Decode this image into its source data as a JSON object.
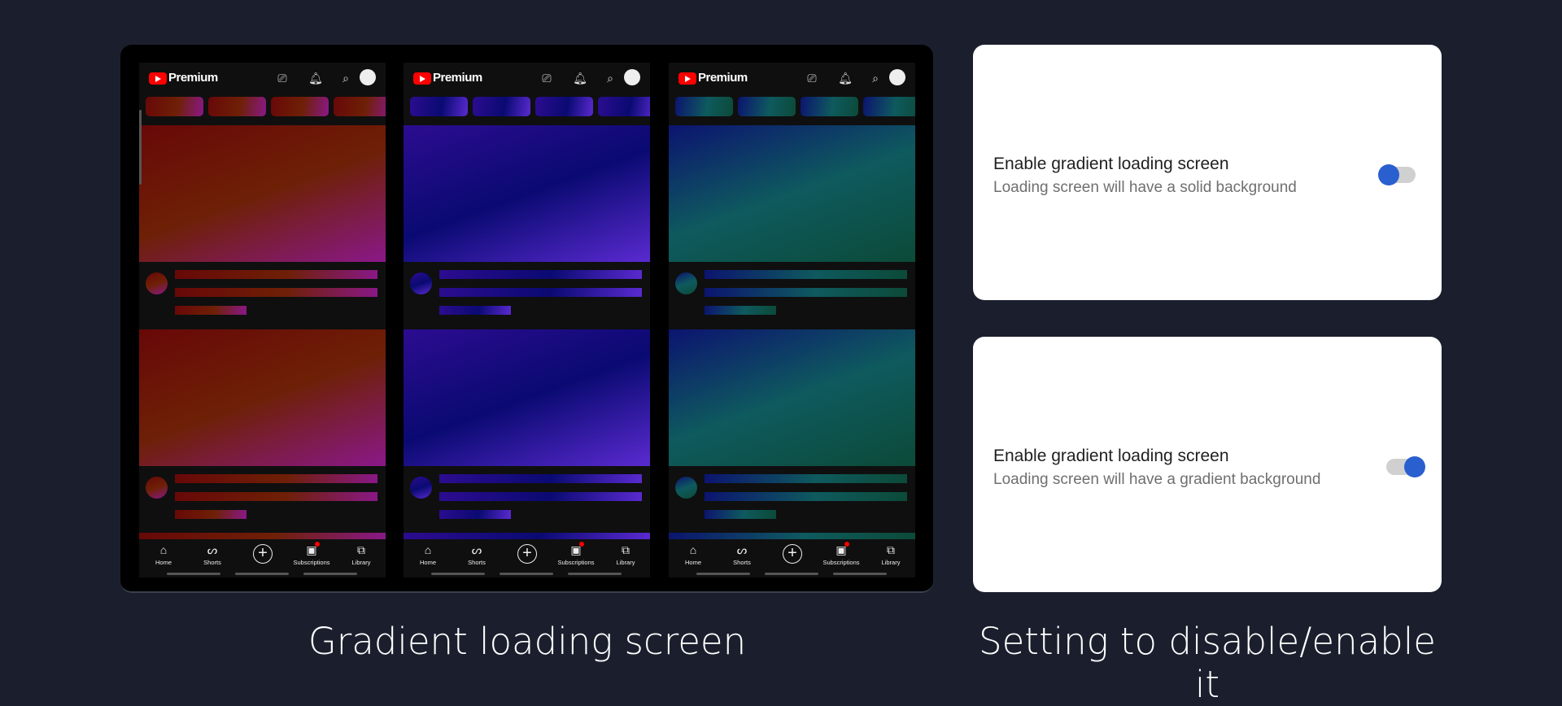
{
  "phones": [
    {
      "brand": "Premium",
      "theme": "red",
      "grad": [
        "#680808",
        "#6e2006",
        "#8a1888"
      ]
    },
    {
      "brand": "Premium",
      "theme": "blue",
      "grad": [
        "#2c0c90",
        "#0a0a72",
        "#5a2ad0"
      ]
    },
    {
      "brand": "Premium",
      "theme": "teal",
      "grad": [
        "#0c1470",
        "#0e5a5e",
        "#0c4a38"
      ]
    }
  ],
  "nav": {
    "home": "Home",
    "shorts": "Shorts",
    "subscriptions": "Subscriptions",
    "library": "Library"
  },
  "settings": [
    {
      "title": "Enable gradient loading screen",
      "subtitle": "Loading screen will have a solid background",
      "enabled": false
    },
    {
      "title": "Enable gradient loading screen",
      "subtitle": "Loading screen will have a gradient background",
      "enabled": true
    }
  ],
  "accent": "#2a5fd0",
  "captions": {
    "left": "Gradient loading screen",
    "right": "Setting  to disable/enable it"
  }
}
